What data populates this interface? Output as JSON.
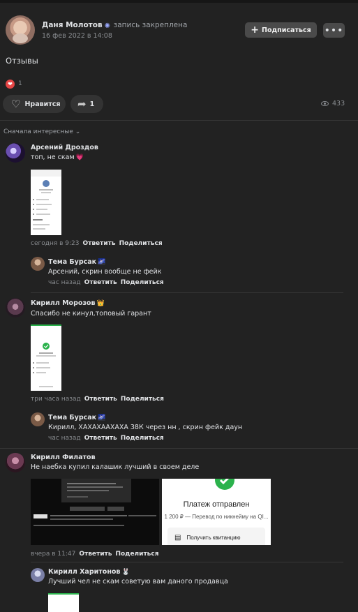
{
  "post": {
    "author": "Даня Молотов",
    "pinned_label": "запись закреплена",
    "date": "16 фев 2022 в 14:08",
    "subscribe_label": "Подписаться",
    "more_label": "•••",
    "text": "Отзывы",
    "reaction_count": "1",
    "like_label": "Нравится",
    "share_count": "1",
    "views": "433"
  },
  "comments_sort": "Сначала интересные",
  "actions": {
    "reply": "Ответить",
    "share": "Поделиться"
  },
  "comments": [
    {
      "name": "Арсений Дроздов",
      "text": "топ, не скам",
      "emoji": "💗",
      "time": "сегодня в 9:23",
      "replies": [
        {
          "name": "Тема Бурсак",
          "text": "Арсений, скрин вообще не фейк",
          "time": "час назад"
        }
      ]
    },
    {
      "name": "Кирилл Морозов",
      "emoji": "👑",
      "text": "Спасибо не кинул,топовый гарант",
      "time": "три часа назад",
      "replies": [
        {
          "name": "Тема Бурсак",
          "text": "Кирилл, ХАХАХААХАХА 38К через нн , скрин фейк даун",
          "time": "час назад"
        }
      ]
    },
    {
      "name": "Кирилл Филатов",
      "text": "Не наебка купил калашик лучший в своем деле",
      "time": "вчера в 11:47",
      "screenshot_title": "Платеж отправлен",
      "screenshot_subtitle": "1 200 ₽ — Перевод по никнейму на QI...",
      "screenshot_button": "Получить квитанцию",
      "replies": [
        {
          "name": "Кирилл Харитонов",
          "emoji": "🐰",
          "text": "Лучший чел не скам советую вам даного продавца"
        }
      ]
    }
  ]
}
